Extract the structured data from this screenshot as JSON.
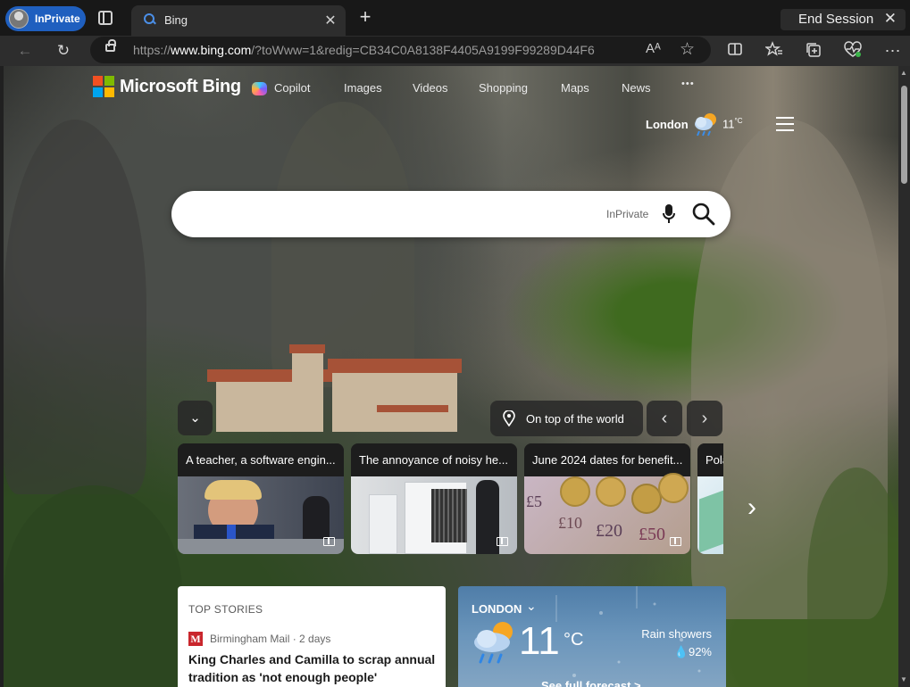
{
  "browser": {
    "profile_label": "InPrivate",
    "tab_title": "Bing",
    "new_tab_glyph": "+",
    "close_glyph": "✕",
    "end_session_label": "End Session",
    "url_prefix": "https://",
    "url_host": "www.bing.com",
    "url_rest": "/?toWww=1&redig=CB34C0A8138F4405A9199F99289D44F6",
    "read_aloud_glyph": "Aᴬ",
    "toolbar_icons": [
      "back-icon",
      "refresh-icon",
      "read-aloud-icon",
      "favorite-star-icon",
      "split-screen-icon",
      "favorites-icon",
      "collections-icon",
      "browser-essentials-icon",
      "more-menu-icon"
    ]
  },
  "bing": {
    "brand": "Microsoft Bing",
    "nav": [
      "Copilot",
      "Images",
      "Videos",
      "Shopping",
      "Maps",
      "News",
      "• • •"
    ],
    "location": "London",
    "temp_small": "11",
    "temp_unit": "°C",
    "search_placeholder": "",
    "search_badge": "InPrivate",
    "image_caption": "On top of the world",
    "stories_header": "TOP STORIES",
    "story": {
      "source_logo": "M",
      "source": "Birmingham Mail · 2 days",
      "headline": "King Charles and Camilla to scrap annual tradition as 'not enough people'"
    },
    "cards": [
      {
        "title": "A teacher, a software engin..."
      },
      {
        "title": "The annoyance of noisy he..."
      },
      {
        "title": "June 2024 dates for benefit..."
      },
      {
        "title": "Pola"
      }
    ],
    "weather": {
      "city": "LONDON",
      "temp": "11",
      "unit": "°C",
      "condition": "Rain showers",
      "precip": "💧92%",
      "more": "See full forecast >"
    }
  },
  "colors": {
    "accent": "#1f5fbf",
    "ms_red": "#f25022",
    "ms_green": "#7fba00",
    "ms_blue": "#00a4ef",
    "ms_yellow": "#ffb900"
  }
}
